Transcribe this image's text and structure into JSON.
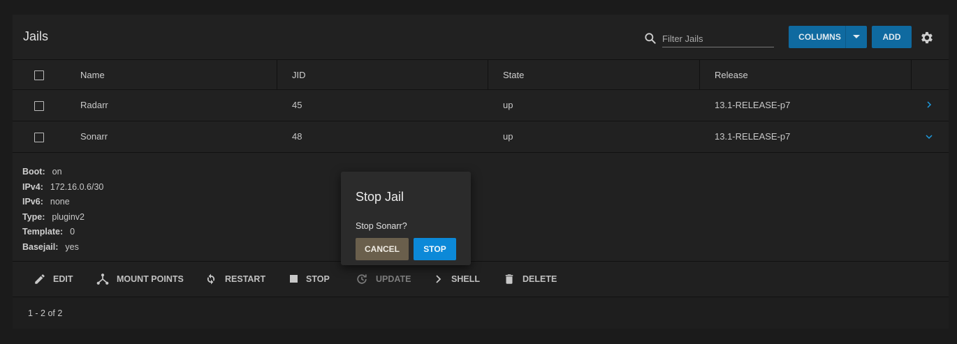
{
  "header": {
    "title": "Jails",
    "filter_placeholder": "Filter Jails",
    "columns_label": "COLUMNS",
    "add_label": "ADD"
  },
  "table": {
    "columns": [
      "Name",
      "JID",
      "State",
      "Release"
    ],
    "rows": [
      {
        "name": "Radarr",
        "jid": "45",
        "state": "up",
        "release": "13.1-RELEASE-p7",
        "expanded": false
      },
      {
        "name": "Sonarr",
        "jid": "48",
        "state": "up",
        "release": "13.1-RELEASE-p7",
        "expanded": true
      }
    ]
  },
  "details": [
    {
      "key": "Boot:",
      "value": "on"
    },
    {
      "key": "IPv4:",
      "value": "172.16.0.6/30"
    },
    {
      "key": "IPv6:",
      "value": "none"
    },
    {
      "key": "Type:",
      "value": "pluginv2"
    },
    {
      "key": "Template:",
      "value": "0"
    },
    {
      "key": "Basejail:",
      "value": "yes"
    }
  ],
  "actions": [
    {
      "label": "EDIT",
      "icon": "pencil-icon"
    },
    {
      "label": "MOUNT POINTS",
      "icon": "mount-points-icon"
    },
    {
      "label": "RESTART",
      "icon": "restart-icon"
    },
    {
      "label": "STOP",
      "icon": "stop-icon"
    },
    {
      "label": "UPDATE",
      "icon": "update-icon"
    },
    {
      "label": "SHELL",
      "icon": "shell-icon"
    },
    {
      "label": "DELETE",
      "icon": "trash-icon"
    }
  ],
  "footer": {
    "range": "1 - 2 of 2"
  },
  "dialog": {
    "title": "Stop Jail",
    "message": "Stop Sonarr?",
    "cancel_label": "CANCEL",
    "confirm_label": "STOP"
  },
  "colors": {
    "primary": "#0f6aa0",
    "accent": "#0c89d8",
    "cancel": "#6a5f4c",
    "background": "#1b1b1b",
    "card": "#212121"
  }
}
